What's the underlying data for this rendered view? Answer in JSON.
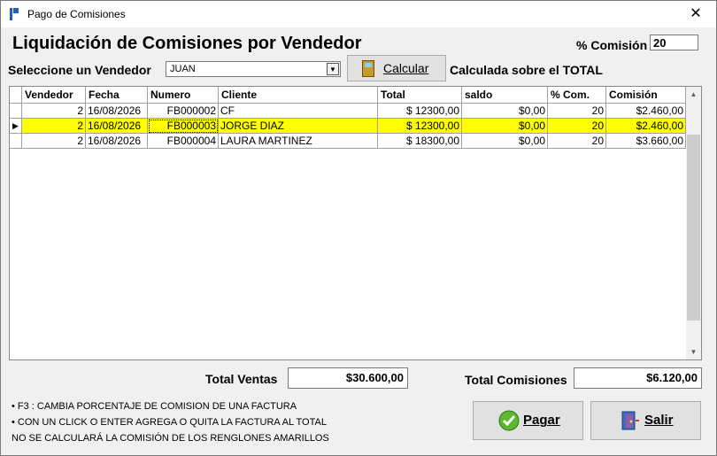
{
  "window": {
    "title": "Pago de Comisiones",
    "close_glyph": "✕"
  },
  "heading": "Liquidación de Comisiones por Vendedor",
  "commission_pct": {
    "label": "% Comisión",
    "value": "20"
  },
  "vendor": {
    "label": "Seleccione un Vendedor",
    "selected": "JUAN"
  },
  "calc_button": {
    "label": "Calcular",
    "icon": "calculator-icon"
  },
  "calc_note": "Calculada sobre el TOTAL",
  "table": {
    "columns": [
      "Vendedor",
      "Fecha",
      "Numero",
      "Cliente",
      "Total",
      "saldo",
      "% Com.",
      "Comisión"
    ],
    "rows": [
      {
        "vendedor": "2",
        "fecha": "16/08/2026",
        "numero": "FB000002",
        "cliente": "CF",
        "total": "$ 12300,00",
        "saldo": "$0,00",
        "pct": "20",
        "comision": "$2.460,00",
        "highlight": false,
        "current": false
      },
      {
        "vendedor": "2",
        "fecha": "16/08/2026",
        "numero": "FB000003",
        "cliente": "JORGE DIAZ",
        "total": "$ 12300,00",
        "saldo": "$0,00",
        "pct": "20",
        "comision": "$2.460,00",
        "highlight": true,
        "current": true
      },
      {
        "vendedor": "2",
        "fecha": "16/08/2026",
        "numero": "FB000004",
        "cliente": "LAURA MARTINEZ",
        "total": "$ 18300,00",
        "saldo": "$0,00",
        "pct": "20",
        "comision": "$3.660,00",
        "highlight": false,
        "current": false
      }
    ],
    "highlight_color": "#ffff00"
  },
  "totals": {
    "ventas_label": "Total Ventas",
    "ventas_value": "$30.600,00",
    "comisiones_label": "Total Comisiones",
    "comisiones_value": "$6.120,00"
  },
  "notes": [
    "•  F3  : CAMBIA PORCENTAJE DE COMISION DE UNA FACTURA",
    "•  CON UN CLICK O ENTER AGREGA O QUITA  LA FACTURA AL TOTAL",
    "NO SE CALCULARÁ LA COMISIÓN DE LOS RENGLONES AMARILLOS"
  ],
  "buttons": {
    "pagar": {
      "label": "Pagar",
      "icon": "check-icon"
    },
    "salir": {
      "label": "Salir",
      "icon": "exit-door-icon"
    }
  }
}
